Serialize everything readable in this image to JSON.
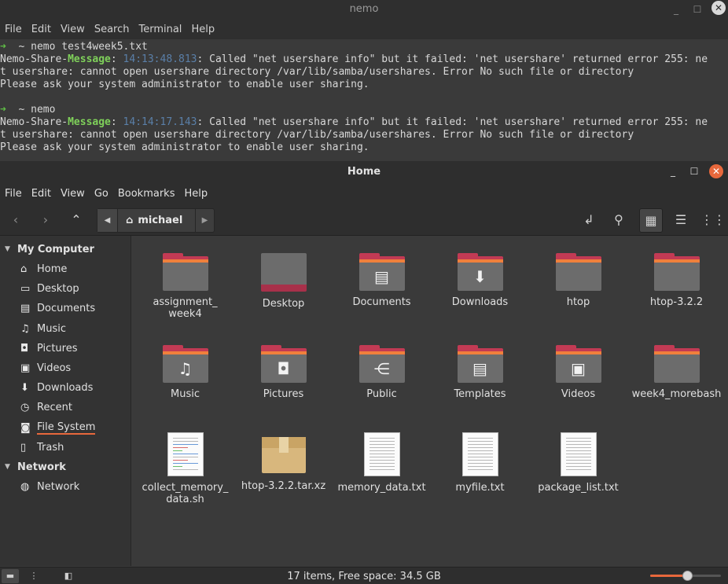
{
  "terminal": {
    "title": "nemo",
    "controls": {
      "minimize": "_",
      "maximize": "☐",
      "close": "✕"
    },
    "menu": [
      "File",
      "Edit",
      "View",
      "Search",
      "Terminal",
      "Help"
    ],
    "lines": [
      {
        "type": "prompt",
        "arrow": "➜",
        "dir": "~",
        "cmd": "nemo test4week5.txt"
      },
      {
        "type": "msg",
        "prefix": "Nemo-Share-",
        "tag": "Message",
        "colon": ": ",
        "time": "14:13:48.813",
        "text": ": Called \"net usershare info\" but it failed: 'net usershare' returned error 255: ne"
      },
      {
        "type": "plain",
        "text": "t usershare: cannot open usershare directory /var/lib/samba/usershares. Error No such file or directory"
      },
      {
        "type": "plain",
        "text": "Please ask your system administrator to enable user sharing."
      },
      {
        "type": "plain",
        "text": ""
      },
      {
        "type": "prompt",
        "arrow": "➜",
        "dir": "~",
        "cmd": "nemo"
      },
      {
        "type": "msg",
        "prefix": "Nemo-Share-",
        "tag": "Message",
        "colon": ": ",
        "time": "14:14:17.143",
        "text": ": Called \"net usershare info\" but it failed: 'net usershare' returned error 255: ne"
      },
      {
        "type": "plain",
        "text": "t usershare: cannot open usershare directory /var/lib/samba/usershares. Error No such file or directory"
      },
      {
        "type": "plain",
        "text": "Please ask your system administrator to enable user sharing."
      }
    ]
  },
  "fm": {
    "title": "Home",
    "controls": {
      "minimize": "_",
      "maximize": "☐",
      "close": "✕"
    },
    "menu": [
      "File",
      "Edit",
      "View",
      "Go",
      "Bookmarks",
      "Help"
    ],
    "toolbar": {
      "back_icon": "‹",
      "forward_icon": "›",
      "up_icon": "⌃",
      "path_left": "◀",
      "path_right": "▶",
      "crumb_icon": "⌂",
      "crumb": "michael",
      "toggle_location_icon": "↲",
      "search_icon": "⚲",
      "icon_view_icon": "▦",
      "list_view_icon": "☰",
      "compact_view_icon": "⋮⋮"
    },
    "sidebar": {
      "sections": [
        {
          "title": "My Computer",
          "toggle": "▼",
          "items": [
            {
              "icon": "⌂",
              "label": "Home"
            },
            {
              "icon": "▭",
              "label": "Desktop"
            },
            {
              "icon": "▤",
              "label": "Documents"
            },
            {
              "icon": "♫",
              "label": "Music"
            },
            {
              "icon": "◘",
              "label": "Pictures"
            },
            {
              "icon": "▣",
              "label": "Videos"
            },
            {
              "icon": "⬇",
              "label": "Downloads"
            },
            {
              "icon": "◷",
              "label": "Recent"
            },
            {
              "icon": "◙",
              "label": "File System"
            },
            {
              "icon": "▯",
              "label": "Trash"
            }
          ]
        },
        {
          "title": "Network",
          "toggle": "▼",
          "items": [
            {
              "icon": "◍",
              "label": "Network"
            }
          ]
        }
      ]
    },
    "files": [
      {
        "name": "assignment_\nweek4",
        "kind": "folder",
        "emblem": ""
      },
      {
        "name": "Desktop",
        "kind": "desktop",
        "emblem": ""
      },
      {
        "name": "Documents",
        "kind": "folder",
        "emblem": "▤"
      },
      {
        "name": "Downloads",
        "kind": "folder",
        "emblem": "⬇"
      },
      {
        "name": "htop",
        "kind": "folder",
        "emblem": ""
      },
      {
        "name": "htop-3.2.2",
        "kind": "folder",
        "emblem": ""
      },
      {
        "name": "Music",
        "kind": "folder",
        "emblem": "♫"
      },
      {
        "name": "Pictures",
        "kind": "folder",
        "emblem": "◘"
      },
      {
        "name": "Public",
        "kind": "folder",
        "emblem": "⋲"
      },
      {
        "name": "Templates",
        "kind": "folder",
        "emblem": "▤"
      },
      {
        "name": "Videos",
        "kind": "folder",
        "emblem": "▣"
      },
      {
        "name": "week4_morebash",
        "kind": "folder",
        "emblem": ""
      },
      {
        "name": "collect_memory_\ndata.sh",
        "kind": "script",
        "emblem": ""
      },
      {
        "name": "htop-3.2.2.tar.xz",
        "kind": "archive",
        "emblem": ""
      },
      {
        "name": "memory_data.txt",
        "kind": "text",
        "emblem": ""
      },
      {
        "name": "myfile.txt",
        "kind": "text",
        "emblem": ""
      },
      {
        "name": "package_list.txt",
        "kind": "text",
        "emblem": ""
      }
    ],
    "status": {
      "text": "17 items, Free space: 34.5 GB",
      "places_icon": "▬",
      "tree_icon": "⋮",
      "hide_sidebar_icon": "◧",
      "zoom_fraction": 0.52
    }
  }
}
